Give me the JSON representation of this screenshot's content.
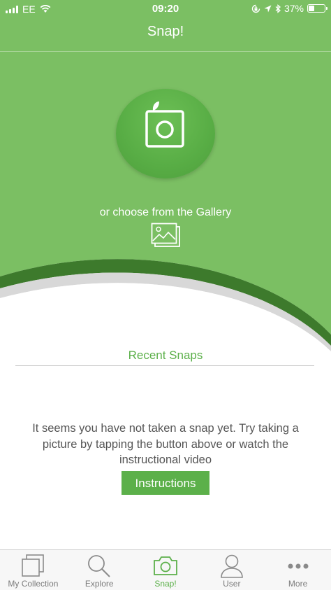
{
  "colors": {
    "brand_green": "#7bbf63",
    "accent_green": "#5cb04a",
    "text_gray": "#555555",
    "tab_inactive": "#7c7c7c"
  },
  "status_bar": {
    "carrier": "EE",
    "time": "09:20",
    "battery_percent": "37%",
    "battery_level": 0.37,
    "icons": [
      "signal-icon",
      "wifi-icon",
      "rotation-lock-icon",
      "location-icon",
      "bluetooth-icon",
      "battery-icon"
    ]
  },
  "header": {
    "title": "Snap!"
  },
  "snap": {
    "icon": "camera-icon",
    "gallery_text": "or choose from the Gallery",
    "gallery_icon": "gallery-icon"
  },
  "recent": {
    "title": "Recent Snaps",
    "empty_message": "It seems you have not taken a snap yet. Try taking a picture by tapping the button above or watch the instructional video",
    "button_label": "Instructions"
  },
  "tabs": [
    {
      "label": "My Collection",
      "icon": "collection-icon",
      "active": false
    },
    {
      "label": "Explore",
      "icon": "search-icon",
      "active": false
    },
    {
      "label": "Snap!",
      "icon": "camera-icon",
      "active": true
    },
    {
      "label": "User",
      "icon": "user-icon",
      "active": false
    },
    {
      "label": "More",
      "icon": "more-icon",
      "active": false
    }
  ]
}
